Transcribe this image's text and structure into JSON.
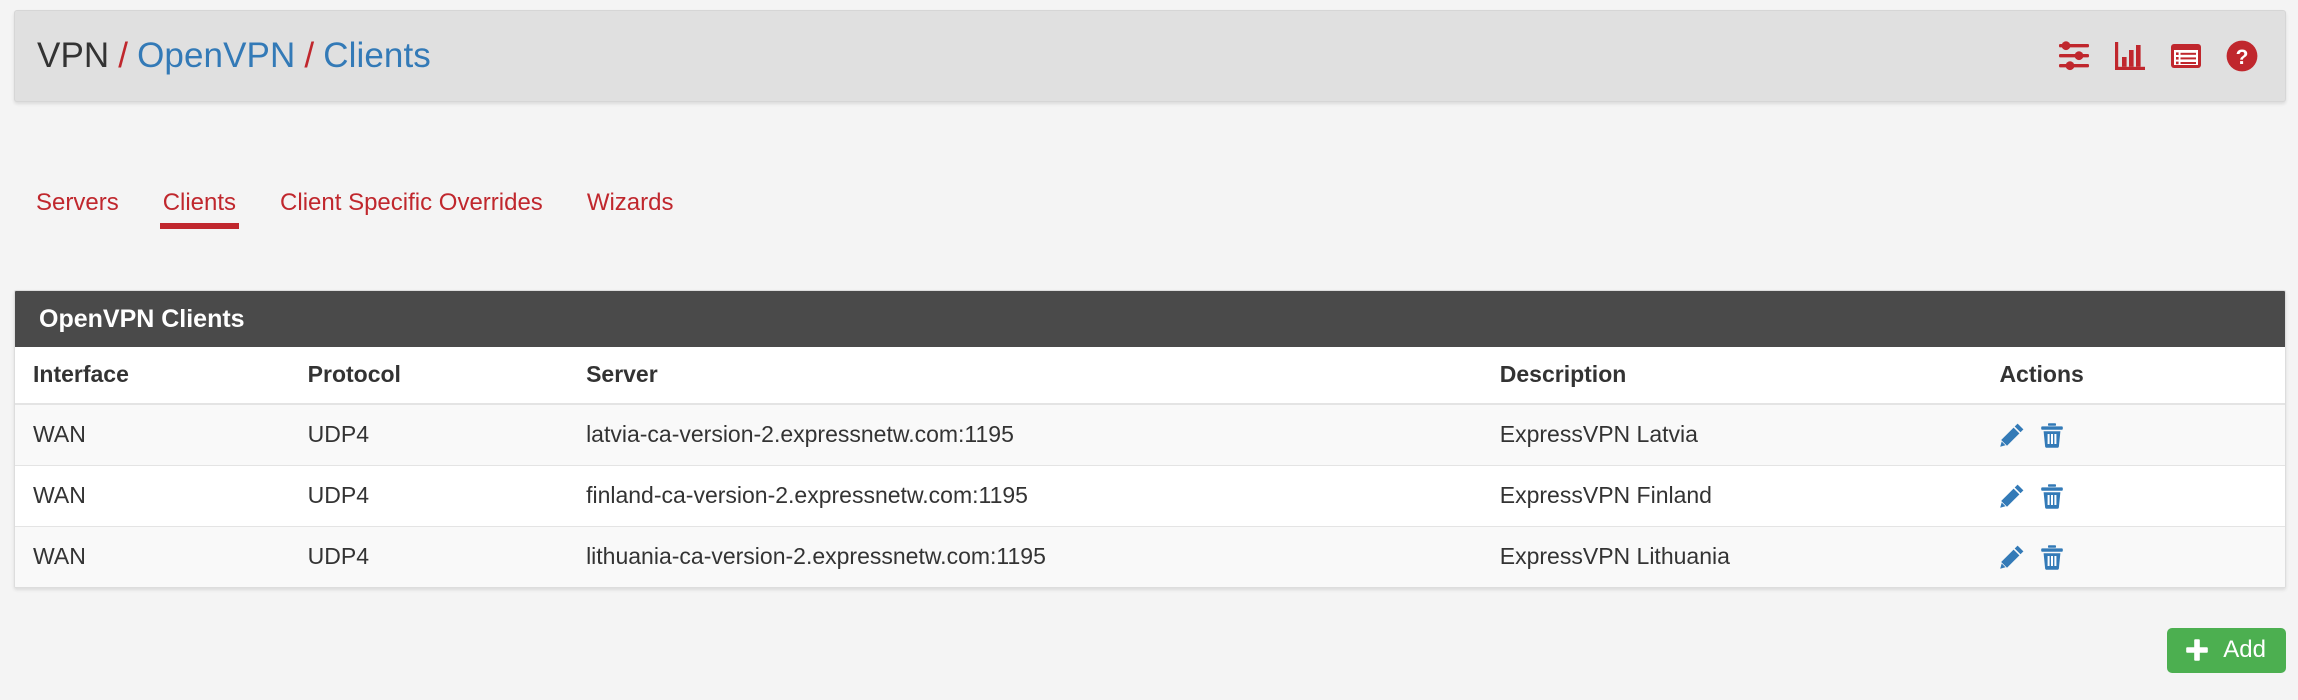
{
  "header": {
    "breadcrumb": {
      "root": "VPN",
      "section": "OpenVPN",
      "page": "Clients",
      "separator": "/"
    },
    "icons": [
      {
        "name": "sliders-icon",
        "title": "Advanced settings"
      },
      {
        "name": "bar-chart-icon",
        "title": "Status / Monitoring"
      },
      {
        "name": "log-list-icon",
        "title": "Logs"
      },
      {
        "name": "help-circle-icon",
        "title": "Help"
      }
    ]
  },
  "tabs": [
    {
      "label": "Servers",
      "active": false
    },
    {
      "label": "Clients",
      "active": true
    },
    {
      "label": "Client Specific Overrides",
      "active": false
    },
    {
      "label": "Wizards",
      "active": false
    }
  ],
  "panel": {
    "title": "OpenVPN Clients",
    "columns": [
      "Interface",
      "Protocol",
      "Server",
      "Description",
      "Actions"
    ],
    "rows": [
      {
        "interface": "WAN",
        "protocol": "UDP4",
        "server": "latvia-ca-version-2.expressnetw.com:1195",
        "description": "ExpressVPN Latvia",
        "actions": [
          "edit-icon",
          "delete-icon"
        ]
      },
      {
        "interface": "WAN",
        "protocol": "UDP4",
        "server": "finland-ca-version-2.expressnetw.com:1195",
        "description": "ExpressVPN Finland",
        "actions": [
          "edit-icon",
          "delete-icon"
        ]
      },
      {
        "interface": "WAN",
        "protocol": "UDP4",
        "server": "lithuania-ca-version-2.expressnetw.com:1195",
        "description": "ExpressVPN Lithuania",
        "actions": [
          "edit-icon",
          "delete-icon"
        ]
      }
    ]
  },
  "footer": {
    "add_label": "Add"
  },
  "colors": {
    "accent_red": "#c0272d",
    "link_blue": "#337ab7",
    "panel_header": "#4a4a4a",
    "add_green": "#4caf50",
    "header_bg": "#e0e0e0",
    "page_bg": "#f4f4f4"
  }
}
